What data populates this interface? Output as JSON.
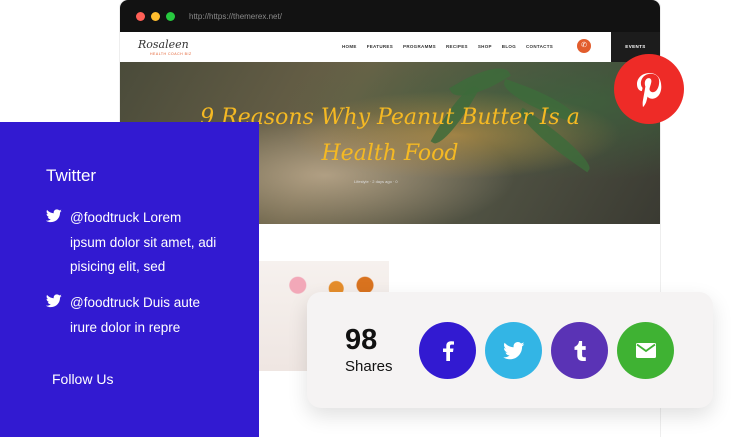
{
  "browser": {
    "url": "http://https://themerex.net/"
  },
  "site": {
    "logo": "Rosaleen",
    "logo_sub": "HEALTH COACH BIZ",
    "nav": [
      "HOME",
      "FEATURES",
      "PROGRAMMS",
      "RECIPES",
      "SHOP",
      "BLOG",
      "CONTACTS"
    ],
    "events_label": "EVENTS",
    "hero_title_line1": "9 Reasons Why Peanut Butter Is a",
    "hero_title_line2": "Health Food",
    "hero_meta": "Lifestyle · 2 days ago · 0",
    "colors": {
      "title": "#f5b923",
      "accent": "#e25d2d"
    }
  },
  "pinterest": {
    "icon": "pinterest-icon",
    "color": "#ee2b27"
  },
  "twitter_panel": {
    "title": "Twitter",
    "tweets": [
      "@foodtruck Lorem ipsum dolor sit amet, adi pisicing elit, sed",
      "@foodtruck Duis aute irure dolor in repre"
    ],
    "follow_label": "Follow Us",
    "color": "#321ad1"
  },
  "share_card": {
    "count": "98",
    "label": "Shares",
    "buttons": [
      {
        "icon": "facebook-icon",
        "color": "#321ad1"
      },
      {
        "icon": "twitter-icon",
        "color": "#33b5e5"
      },
      {
        "icon": "tumblr-icon",
        "color": "#5a33b5"
      },
      {
        "icon": "email-icon",
        "color": "#3fb233"
      }
    ]
  }
}
